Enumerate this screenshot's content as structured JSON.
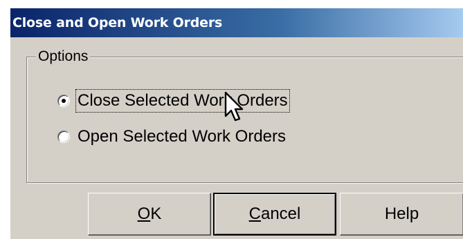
{
  "dialog": {
    "title": "Close and Open Work Orders",
    "group_label": "Options",
    "options": [
      {
        "label": "Close Selected Work Orders",
        "selected": true
      },
      {
        "label": "Open Selected Work Orders",
        "selected": false
      }
    ],
    "buttons": {
      "ok": {
        "mnemonic": "O",
        "rest": "K"
      },
      "cancel": {
        "mnemonic": "C",
        "rest": "ancel"
      },
      "help": "Help"
    }
  },
  "colors": {
    "face": "#d4d0c8",
    "titlebar_start": "#0a246a",
    "titlebar_end": "#a6caf0"
  },
  "icons": {
    "cursor": "arrow-pointer-icon"
  }
}
